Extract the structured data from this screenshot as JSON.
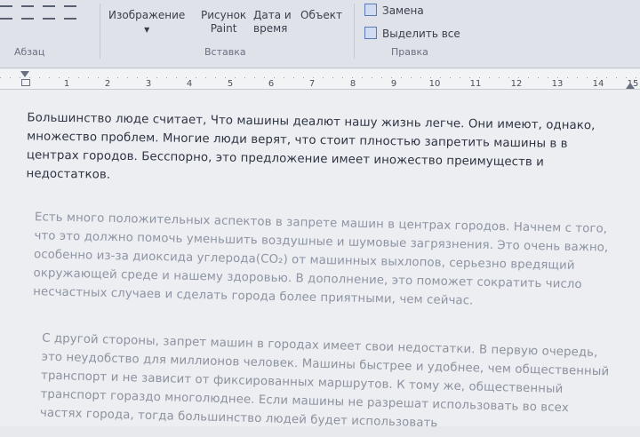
{
  "ribbon": {
    "groups": {
      "paragraph": "Абзац",
      "insert": "Вставка",
      "editing": "Правка"
    },
    "buttons": {
      "image": "Изображение",
      "paint_line1": "Рисунок",
      "paint_line2": "Paint",
      "datetime_line1": "Дата и",
      "datetime_line2": "время",
      "object": "Объект",
      "replace": "Замена",
      "select_all": "Выделить все"
    }
  },
  "ruler": {
    "ticks": [
      "1",
      "2",
      "3",
      "4",
      "5",
      "6",
      "7",
      "8",
      "9",
      "10",
      "11",
      "12",
      "13",
      "14",
      "15"
    ]
  },
  "document": {
    "paragraphs": [
      "Большинство люде считает, Что машины деалют нашу жизнь легче. Они имеют, однако, множество проблем. Многие люди верят, что стоит плностью запретить машины в в центрах городов. Бесспорно, это предложение имеет иножество преимуществ и недостатков.",
      "Есть много положительных аспектов в запрете машин в центрах городов. Начнем с того, что это должно помочь уменьшить воздушные и шумовые загрязнения. Это очень важно, особенно из-за диоксида углерода(CO₂) от машинных выхлопов, серьезно вредящий окружающей среде и нашему здоровью. В дополнение, это поможет сократить число несчастных случаев и сделать города более приятными, чем сейчас.",
      "С другой стороны, запрет машин в городах имеет свои недостатки. В первую очередь, это неудобство для миллионов человек. Машины быстрее и удобнее, чем общественный транспорт и не зависит от фиксированных маршрутов. К тому же, общественный транспорт гораздо многолюднее. Если машины не разрешат использовать во всех частях города, тогда большинство людей будет использовать"
    ]
  }
}
